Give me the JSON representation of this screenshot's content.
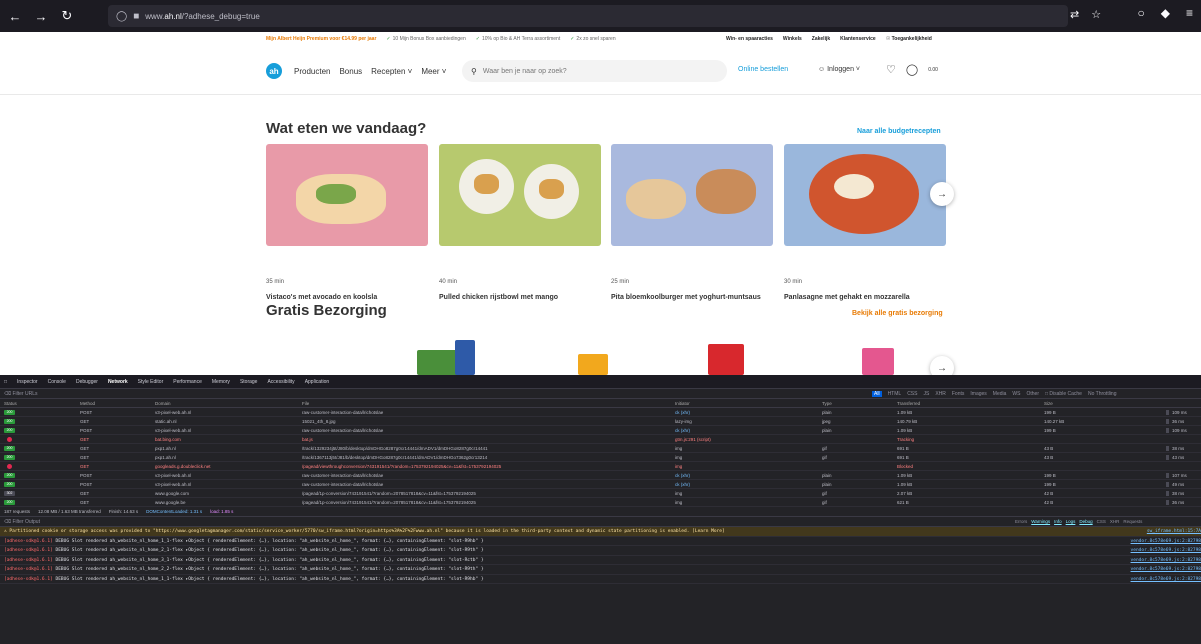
{
  "browser": {
    "url_prefix": "www.",
    "url_host": "ah.nl",
    "url_path": "/?adhese_debug=true"
  },
  "usp_bar": {
    "premium": "Mijn Albert Heijn Premium voor €14.99 per jaar",
    "items": [
      "10 Mijn Bonus Box aanbiedingen",
      "10% op Bio & AH Terra assortiment",
      "2x zo snel sparen"
    ],
    "util_links": [
      "Win- en spaaracties",
      "Winkels",
      "Zakelijk",
      "Klantenservice",
      "Toegankelijkheid"
    ]
  },
  "nav": {
    "links": [
      "Producten",
      "Bonus",
      "Recepten",
      "Meer"
    ],
    "search_placeholder": "Waar ben je naar op zoek?",
    "online_bestellen": "Online bestellen",
    "login": "Inloggen",
    "cart_total": "0.00"
  },
  "recipes": {
    "title": "Wat eten we vandaag?",
    "link": "Naar alle budgetrecepten",
    "cards": [
      {
        "time": "35 min",
        "name": "Vistaco's met avocado en koolsla",
        "bg": "#e89aa8"
      },
      {
        "time": "40 min",
        "name": "Pulled chicken rijstbowl met mango",
        "bg": "#b7c96e"
      },
      {
        "time": "25 min",
        "name": "Pita bloemkoolburger met yoghurt-muntsaus",
        "bg": "#a9b9de"
      },
      {
        "time": "30 min",
        "name": "Panlasagne met gehakt en mozzarella",
        "bg": "#9ab7dc"
      }
    ]
  },
  "delivery": {
    "title": "Gratis Bezorging",
    "link": "Bekijk alle gratis bezorging"
  },
  "devtools": {
    "tabs": [
      "Inspector",
      "Console",
      "Debugger",
      "Network",
      "Style Editor",
      "Performance",
      "Memory",
      "Storage",
      "Accessibility",
      "Application"
    ],
    "filter_urls": "Filter URLs",
    "filter_types": [
      "All",
      "HTML",
      "CSS",
      "JS",
      "XHR",
      "Fonts",
      "Images",
      "Media",
      "WS",
      "Other"
    ],
    "disable_cache": "Disable Cache",
    "throttling": "No Throttling",
    "columns": [
      "Status",
      "Method",
      "Domain",
      "File",
      "Initiator",
      "Type",
      "Transferred",
      "Size"
    ],
    "rows": [
      {
        "status": "200",
        "method": "POST",
        "domain": "v3-pixel-web.ah.nl",
        "file": "raw-customer-interaction-data/lrichotslae",
        "initiator": "ck (xhr)",
        "type": "plain",
        "transferred": "1.09 kB",
        "size": "199 B",
        "ms": "109 ms"
      },
      {
        "status": "200",
        "method": "GET",
        "domain": "static.ah.nl",
        "file": "15021_4th_8.jpg",
        "initiator": "lazy-img",
        "type": "jpeg",
        "transferred": "140.79 kB",
        "size": "140.27 kB",
        "ms": "36 ms"
      },
      {
        "status": "200",
        "method": "POST",
        "domain": "v3-pixel-web.ah.nl",
        "file": "raw-customer-interaction-data/lrichotslae",
        "initiator": "ck (xhr)",
        "type": "plain",
        "transferred": "1.09 kB",
        "size": "199 B",
        "ms": "109 ms"
      },
      {
        "status": "blocked",
        "method": "GET",
        "domain": "bat.bing.com",
        "file": "bat.js",
        "initiator": "gtm.js:291 (script)",
        "type": "",
        "transferred": "Tracking",
        "size": "",
        "ms": ""
      },
      {
        "status": "200",
        "method": "GET",
        "domain": "pxp1.ah.nl",
        "file": "/track/1329234j5t/J80/b/desktop/dmDHGo8287g0cr14441/dmADV1/dmDHGo8287g0cr14441",
        "initiator": "img",
        "type": "gif",
        "transferred": "691 B",
        "size": "43 B",
        "ms": "38 ms"
      },
      {
        "status": "200",
        "method": "GET",
        "domain": "pxp1.ah.nl",
        "file": "/track/1367113j5t/J81/b/desktop/dmDHGo8287g0cr14441/dmADV1/dmDHGo7362g0cr13214",
        "initiator": "img",
        "type": "gif",
        "transferred": "691 B",
        "size": "43 B",
        "ms": "43 ms"
      },
      {
        "status": "blocked",
        "method": "GET",
        "domain": "googleads.g.doubleclick.net",
        "file": "/pagead/viewthroughconversion/743191541/?random=1753792194025&cv=11&fst=1753792194025",
        "initiator": "img",
        "type": "",
        "transferred": "Blocked",
        "size": "",
        "ms": ""
      },
      {
        "status": "200",
        "method": "POST",
        "domain": "v3-pixel-web.ah.nl",
        "file": "raw-customer-interaction-data/lrichotslae",
        "initiator": "ck (xhr)",
        "type": "plain",
        "transferred": "1.09 kB",
        "size": "199 B",
        "ms": "107 ms"
      },
      {
        "status": "200",
        "method": "POST",
        "domain": "v3-pixel-web.ah.nl",
        "file": "raw-customer-interaction-data/lrichotslae",
        "initiator": "ck (xhr)",
        "type": "plain",
        "transferred": "1.09 kB",
        "size": "199 B",
        "ms": "49 ms"
      },
      {
        "status": "302",
        "method": "GET",
        "domain": "www.google.com",
        "file": "/pagead/1p-conversion/743191541/?random=2078517818&cv=11&fst=1753792194025",
        "initiator": "img",
        "type": "gif",
        "transferred": "2.07 kB",
        "size": "42 B",
        "ms": "38 ms"
      },
      {
        "status": "200",
        "method": "GET",
        "domain": "www.google.be",
        "file": "/pagead/1p-conversion/743191541/?random=2078517818&cv=11&fst=1753792194025",
        "initiator": "img",
        "type": "gif",
        "transferred": "621 B",
        "size": "42 B",
        "ms": "36 ms"
      }
    ],
    "summary": {
      "requests": "187 requests",
      "transferred": "12.08 MB / 1.63 MB transferred",
      "finish": "Finish: 14.63 s",
      "dcl": "DOMContentLoaded: 1.31 s",
      "load": "load: 1.85 s"
    },
    "console_filter": "Filter Output",
    "console_types": [
      "Errors",
      "Warnings",
      "Info",
      "Logs",
      "Debug",
      "CSS",
      "XHR",
      "Requests"
    ],
    "console_rows": [
      {
        "kind": "warn",
        "text": "Partitioned cookie or storage access was provided to \"https://www.googletagmanager.com/static/service_worker/5770/sw_iframe.html?origin=https%3A%2F%2Fwww.ah.nl\" because it is loaded in the third-party context and dynamic state partitioning is enabled. [Learn More]",
        "src": "sw_iframe.html:15:7A"
      },
      {
        "kind": "debug",
        "prefix": "[adhese-sdk@1.6.1]",
        "text": "DEBUG Slot rendered ah_website_nl_home_1_1-flex ▸Object { renderedElement: {…}, location: \"ah_website_nl_home_\", format: {…}, containingElement: \"slot-R9hb\" }",
        "src": "vendor.8c578e69.js:2:82798"
      },
      {
        "kind": "debug",
        "prefix": "[adhese-sdk@1.6.1]",
        "text": "DEBUG Slot rendered ah_website_nl_home_2_1-flex ▸Object { renderedElement: {…}, location: \"ah_website_nl_home_\", format: {…}, containingElement: \"slot-R9th\" }",
        "src": "vendor.8c578e69.js:2:82798"
      },
      {
        "kind": "debug",
        "prefix": "[adhese-sdk@1.6.1]",
        "text": "DEBUG Slot rendered ah_website_nl_home_3_1-flex ▸Object { renderedElement: {…}, location: \"ah_website_nl_home_\", format: {…}, containingElement: \"slot-Rctb\" }",
        "src": "vendor.8c578e69.js:2:82798"
      },
      {
        "kind": "debug",
        "prefix": "[adhese-sdk@1.6.1]",
        "text": "DEBUG Slot rendered ah_website_nl_home_2_2-flex ▸Object { renderedElement: {…}, location: \"ah_website_nl_home_\", format: {…}, containingElement: \"slot-R9th\" }",
        "src": "vendor.8c578e69.js:2:82798"
      },
      {
        "kind": "debug",
        "prefix": "[adhese-sdk@1.6.1]",
        "text": "DEBUG Slot rendered ah_website_nl_home_1_1-flex ▸Object { renderedElement: {…}, location: \"ah_website_nl_home_\", format: {…}, containingElement: \"slot-R9hb\" }",
        "src": "vendor.8c578e69.js:2:82798"
      }
    ]
  }
}
